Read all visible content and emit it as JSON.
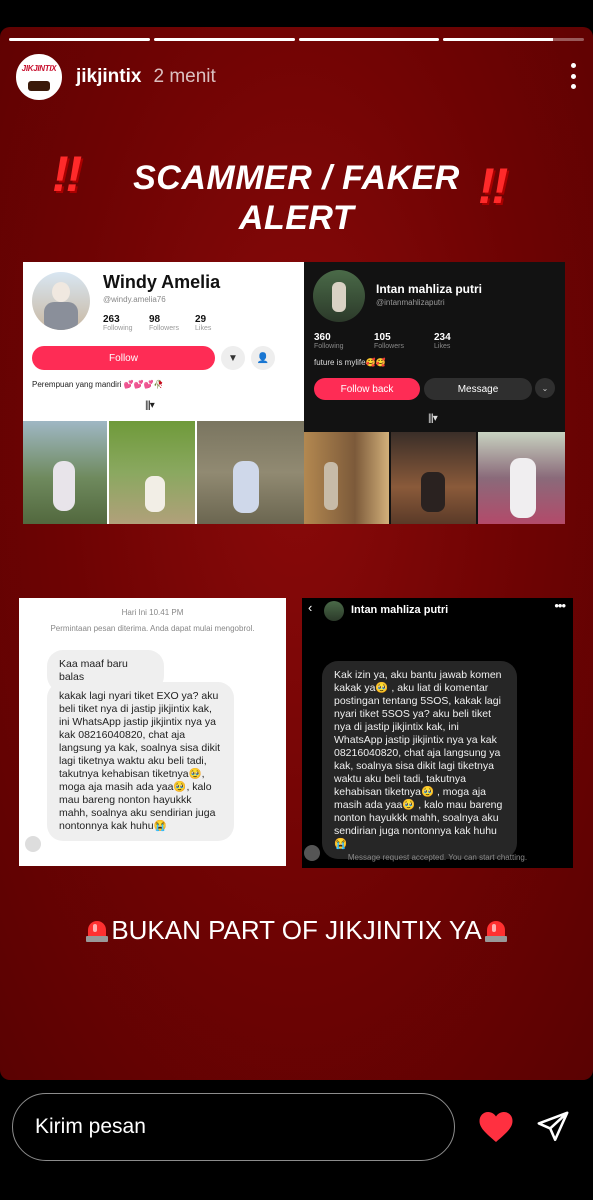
{
  "story": {
    "progress": [
      1.0,
      1.0,
      1.0,
      0.78
    ],
    "username": "jikjintix",
    "time_ago": "2 menit",
    "logo_text": "JIKJINTIX",
    "title_line1": "SCAMMER / FAKER",
    "title_line2": "ALERT",
    "bottom_banner": "BUKAN PART OF JIKJINTIX YA"
  },
  "profile1": {
    "name": "Windy Amelia",
    "handle": "@windy.amelia76",
    "stats": [
      {
        "value": "263",
        "label": "Following"
      },
      {
        "value": "98",
        "label": "Followers"
      },
      {
        "value": "29",
        "label": "Likes"
      }
    ],
    "follow_label": "Follow",
    "bio": "Perempuan yang mandiri 💕💕💕🥀"
  },
  "profile2": {
    "name": "Intan mahliza putri",
    "handle": "@intanmahlizaputri",
    "stats": [
      {
        "value": "360",
        "label": "Following"
      },
      {
        "value": "105",
        "label": "Followers"
      },
      {
        "value": "234",
        "label": "Likes"
      }
    ],
    "bio": "future is mylife🥰🥰",
    "follow_back_label": "Follow back",
    "message_label": "Message"
  },
  "chat1": {
    "time": "Hari Ini 10.41 PM",
    "notice": "Permintaan pesan diterima. Anda dapat mulai mengobrol.",
    "msg1": "Kaa maaf baru balas",
    "msg2": "kakak lagi nyari tiket EXO ya? aku beli tiket nya di jastip jikjintix kak, ini WhatsApp jastip jikjintix nya ya kak 08216040820, chat aja langsung ya kak, soalnya sisa dikit lagi tiketnya waktu aku beli tadi, takutnya kehabisan tiketnya🥹, moga aja masih ada yaa🥹, kalo mau bareng nonton hayukkk mahh, soalnya aku sendirian juga nontonnya kak huhu😭"
  },
  "chat2": {
    "contact": "Intan mahliza putri",
    "msg": "Kak izin ya, aku bantu jawab komen kakak ya🥹 , aku liat di komentar postingan tentang 5SOS, kakak lagi nyari tiket 5SOS ya? aku beli tiket nya di jastip jikjintix kak, ini WhatsApp jastip jikjintix nya ya kak 08216040820, chat aja langsung ya kak, soalnya sisa dikit lagi tiketnya waktu aku beli tadi, takutnya kehabisan tiketnya🥹 , moga aja masih ada yaa🥹 , kalo mau bareng nonton hayukkk mahh, soalnya aku sendirian juga nontonnya kak huhu😭",
    "footer": "Message request accepted. You can start chatting."
  },
  "reply": {
    "placeholder": "Kirim pesan"
  },
  "colors": {
    "background": "#6e0303",
    "follow_pink": "#fe2c55",
    "heart": "#ff3040"
  }
}
